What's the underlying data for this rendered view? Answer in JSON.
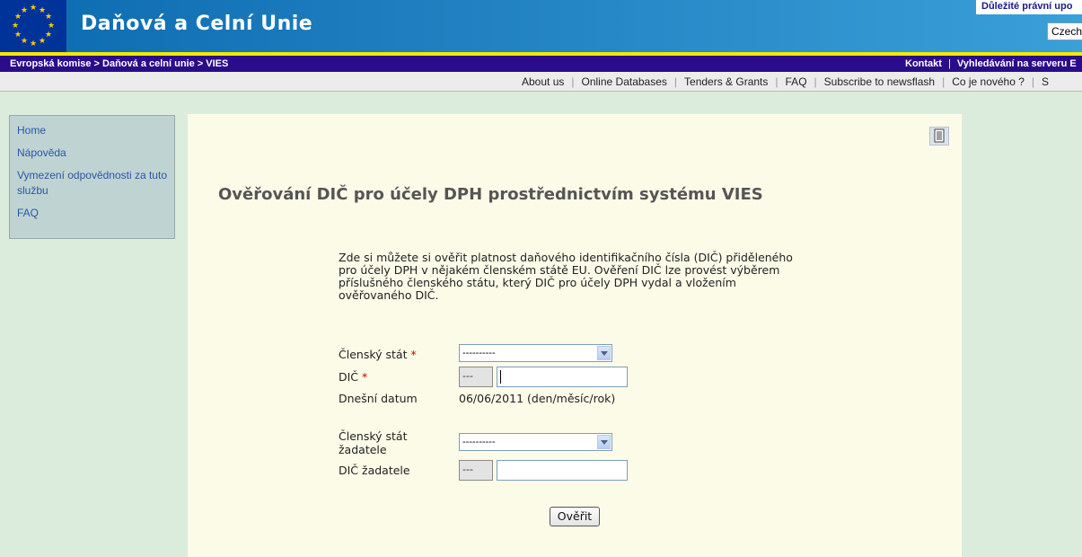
{
  "header": {
    "site_title": "Daňová a Celní Unie",
    "legal_notice": "Důležité právní upo",
    "language": "Czech"
  },
  "breadcrumb": "Evropská komise > Daňová a celní unie > VIES",
  "top_links": [
    "Kontakt",
    "Vyhledávání na serveru E"
  ],
  "nav_links": [
    "About us",
    "Online Databases",
    "Tenders & Grants",
    "FAQ",
    "Subscribe to newsflash",
    "Co je nového ?",
    "S"
  ],
  "sidebar": {
    "items": [
      {
        "label": "Home"
      },
      {
        "label": "Nápověda"
      },
      {
        "label": "Vymezení odpovědnosti za tuto službu"
      },
      {
        "label": "FAQ"
      }
    ]
  },
  "main": {
    "title": "Ověřování DIČ pro účely DPH prostřednictvím systému VIES",
    "intro": "Zde si můžete si ověřit platnost daňového identifikačního čísla (DIČ) přiděleného pro účely DPH v nějakém členském státě EU. Ověření DIČ lze provést výběrem příslušného členského státu, který DIČ pro účely DPH vydal a vložením ověřovaného DIČ.",
    "form": {
      "member_state_label": "Členský stát",
      "member_state_value": "----------",
      "vat_label": "DIČ",
      "vat_prefix": "---",
      "vat_value": "",
      "today_label": "Dnešní datum",
      "today_value": "06/06/2011 (den/měsíc/rok)",
      "requester_state_label": "Členský stát žadatele",
      "requester_state_value": "----------",
      "requester_vat_label": "DIČ žadatele",
      "requester_vat_prefix": "---",
      "requester_vat_value": "",
      "required_mark": "*",
      "submit_label": "Ověřit"
    }
  },
  "colors": {
    "header_blue": "#0c6bb0",
    "breadcrumb_purple": "#2a0c8a",
    "accent_yellow": "#f5e800",
    "page_bg": "#dcecdc",
    "panel_bg": "#fbfbe8",
    "sidebar_bg": "#bfd3d3"
  },
  "icons": [
    "eu-flag-icon",
    "print-icon",
    "chevron-down-icon"
  ]
}
